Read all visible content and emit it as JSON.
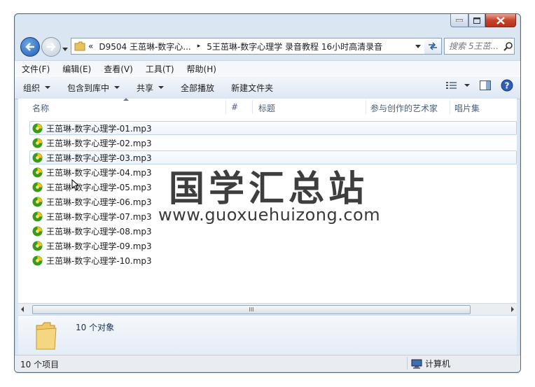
{
  "window": {
    "minimize_icon": "minimize-icon",
    "maximize_icon": "maximize-icon",
    "close_icon": "close-icon"
  },
  "address": {
    "prefix": "«",
    "crumb1": "D9504 王茁琳-数字心...",
    "separator": "▸",
    "crumb2": "5王茁琳-数字心理学 录音教程 16小时高清录音"
  },
  "search": {
    "placeholder": "搜索 5王茁..."
  },
  "menu": [
    "文件(F)",
    "编辑(E)",
    "查看(V)",
    "工具(T)",
    "帮助(H)"
  ],
  "toolbar": {
    "organize": "组织",
    "include": "包含到库中",
    "share": "共享",
    "play_all": "全部播放",
    "new_folder": "新建文件夹"
  },
  "columns": {
    "name": "名称",
    "number": "#",
    "title": "标题",
    "artist": "参与创作的艺术家",
    "album": "唱片集"
  },
  "files": [
    "王茁琳-数字心理学-01.mp3",
    "王茁琳-数字心理学-02.mp3",
    "王茁琳-数字心理学-03.mp3",
    "王茁琳-数字心理学-04.mp3",
    "王茁琳-数字心理学-05.mp3",
    "王茁琳-数字心理学-06.mp3",
    "王茁琳-数字心理学-07.mp3",
    "王茁琳-数字心理学-08.mp3",
    "王茁琳-数字心理学-09.mp3",
    "王茁琳-数字心理学-10.mp3"
  ],
  "scroll_grip": "III",
  "details": {
    "count": "10 个对象"
  },
  "status": {
    "items": "10 个项目",
    "location": "计算机"
  },
  "watermark": {
    "title": "国学汇总站",
    "url": "www.guoxuehuizong.com"
  },
  "colors": {
    "accent": "#1e5cb5",
    "close": "#c7422a",
    "mp3_green": "#3a9a1a",
    "mp3_yellow": "#f0c419"
  }
}
